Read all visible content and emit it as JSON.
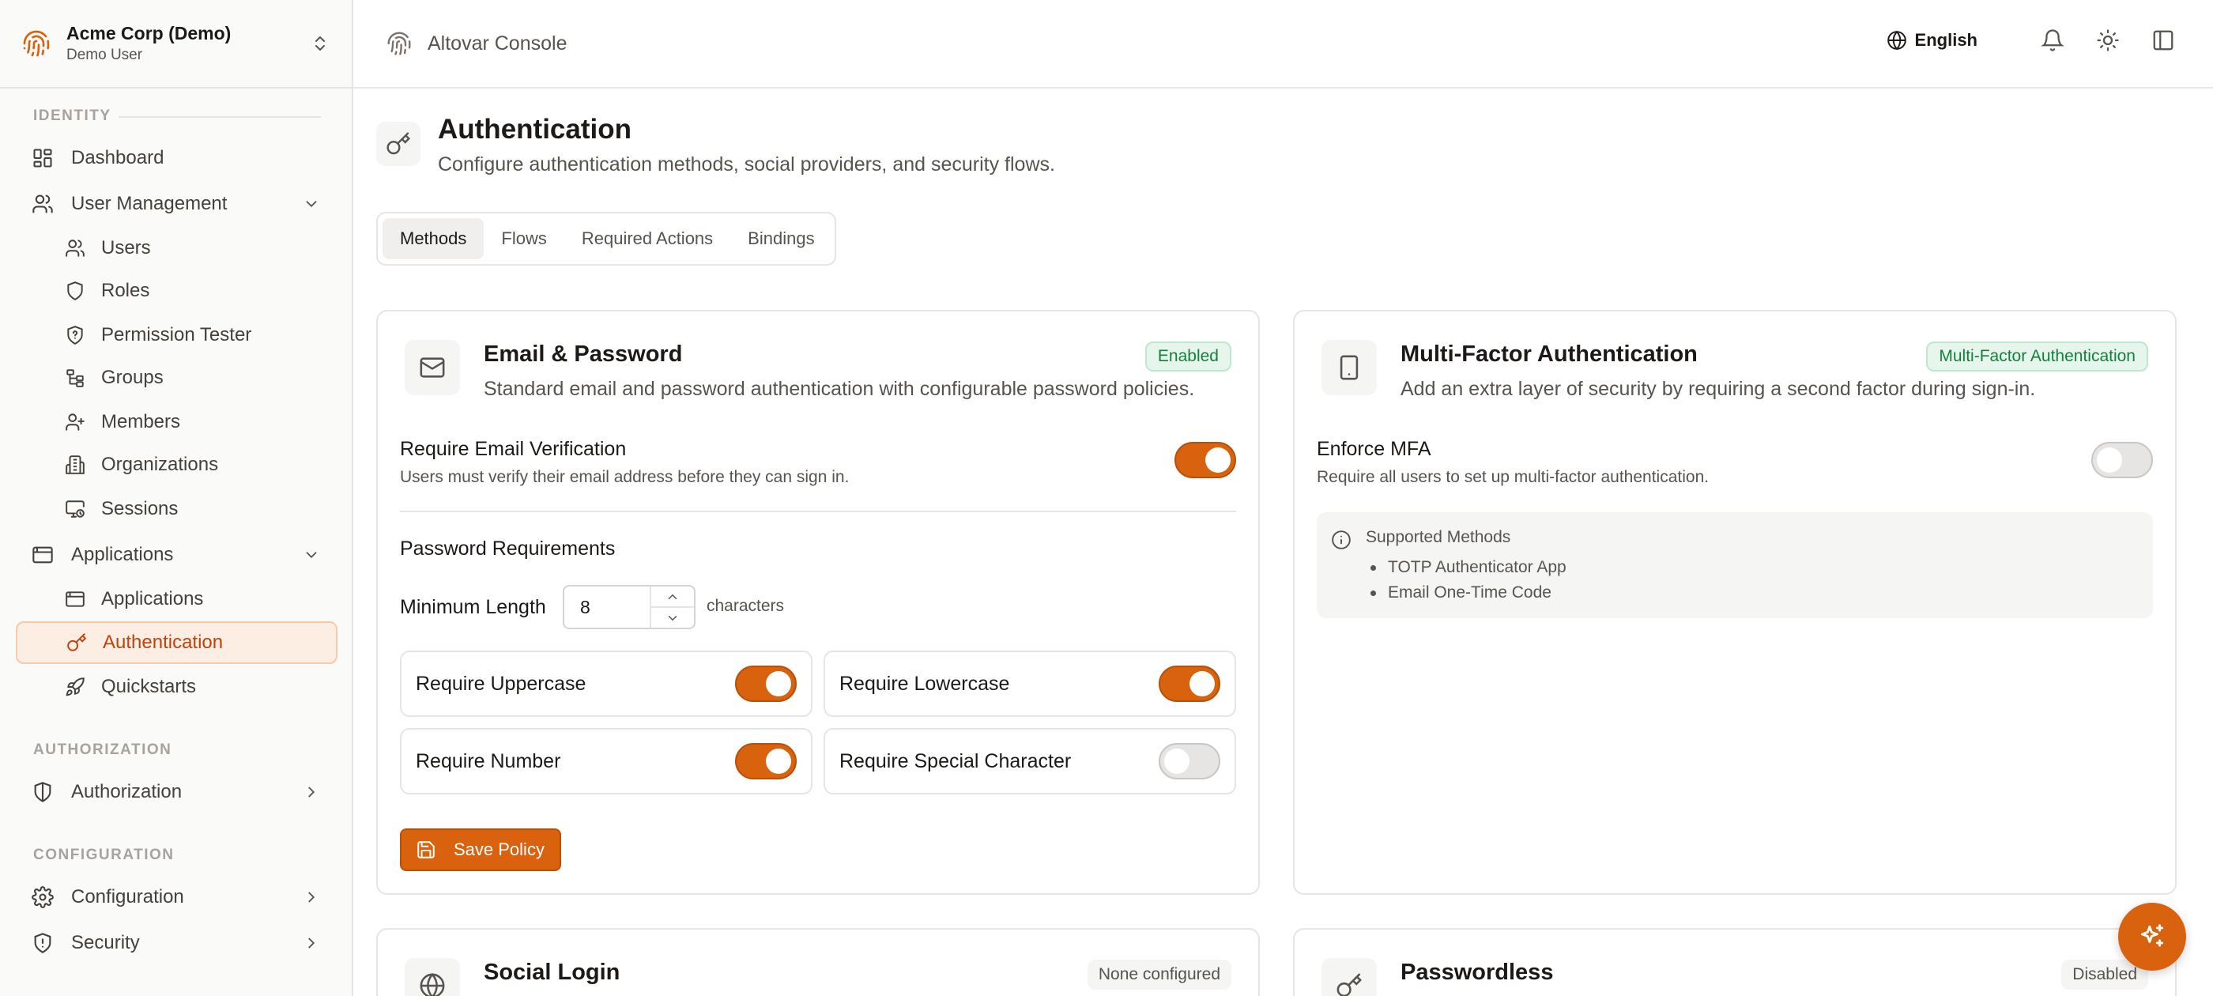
{
  "org": {
    "name": "Acme Corp (Demo)",
    "user": "Demo User"
  },
  "sidebar": {
    "identity_heading": "IDENTITY",
    "authorization_heading": "AUTHORIZATION",
    "configuration_heading": "CONFIGURATION",
    "items": {
      "dashboard": "Dashboard",
      "user_management": "User Management",
      "users": "Users",
      "roles": "Roles",
      "permission_tester": "Permission Tester",
      "groups": "Groups",
      "members": "Members",
      "organizations": "Organizations",
      "sessions": "Sessions",
      "applications_group": "Applications",
      "applications": "Applications",
      "authentication": "Authentication",
      "quickstarts": "Quickstarts",
      "authorization": "Authorization",
      "configuration": "Configuration",
      "security": "Security"
    },
    "active_item": "authentication"
  },
  "header": {
    "title": "Altovar Console",
    "language": "English"
  },
  "page": {
    "title": "Authentication",
    "subtitle": "Configure authentication methods, social providers, and security flows."
  },
  "tabs": {
    "methods": "Methods",
    "flows": "Flows",
    "required_actions": "Required Actions",
    "bindings": "Bindings",
    "active": "methods"
  },
  "email_card": {
    "title": "Email & Password",
    "description": "Standard email and password authentication with configurable password policies.",
    "badge": "Enabled",
    "verify_label": "Require Email Verification",
    "verify_desc": "Users must verify their email address before they can sign in.",
    "verify_on": true,
    "password_heading": "Password Requirements",
    "min_length_label": "Minimum Length",
    "min_length_value": "8",
    "min_length_unit": "characters",
    "options": {
      "uppercase": {
        "label": "Require Uppercase",
        "on": true
      },
      "lowercase": {
        "label": "Require Lowercase",
        "on": true
      },
      "number": {
        "label": "Require Number",
        "on": true
      },
      "special": {
        "label": "Require Special Character",
        "on": false
      }
    },
    "save_label": "Save Policy"
  },
  "mfa_card": {
    "title": "Multi-Factor Authentication",
    "description": "Add an extra layer of security by requiring a second factor during sign-in.",
    "badge": "Multi-Factor Authentication",
    "enforce_label": "Enforce MFA",
    "enforce_desc": "Require all users to set up multi-factor authentication.",
    "enforce_on": false,
    "supported_title": "Supported Methods",
    "methods": [
      "TOTP Authenticator App",
      "Email One-Time Code"
    ]
  },
  "social_card": {
    "title": "Social Login",
    "badge": "None configured"
  },
  "passwordless_card": {
    "title": "Passwordless",
    "badge": "Disabled"
  },
  "colors": {
    "accent": "#d9620f",
    "success": "#15803d",
    "muted": "#57534e"
  }
}
